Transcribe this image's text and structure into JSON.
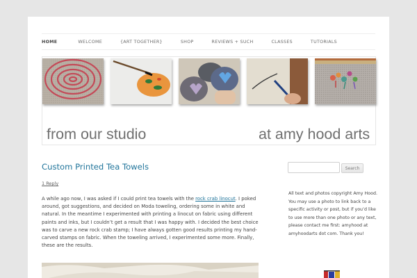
{
  "nav": {
    "items": [
      {
        "label": "HOME",
        "active": true
      },
      {
        "label": "WELCOME"
      },
      {
        "label": "{ART TOGETHER}"
      },
      {
        "label": "SHOP"
      },
      {
        "label": "REVIEWS + SUCH"
      },
      {
        "label": "CLASSES"
      },
      {
        "label": "TUTORIALS"
      }
    ]
  },
  "banner": {
    "caption_left": "from our studio",
    "caption_right": "at amy hood arts",
    "images": [
      "spiral-embroidery",
      "painting-fish-stone",
      "painted-heart-stones",
      "child-drawing",
      "stitched-letters"
    ]
  },
  "post": {
    "title": "Custom Printed Tea Towels",
    "reply": "1 Reply",
    "body_before_link": "A while ago now, I was asked if I could print tea towels with the ",
    "link_text": "rock crab linocut",
    "body_after_link": ". I poked around, got suggestions, and decided on Moda toweling, ordering some in white and natural. In the meantime I experimented with printing a linocut on fabric using different paints and inks, but I couldn’t get a result that I was happy with. I decided the best choice was to carve a new rock crab stamp; I have always gotten good results printing my hand-carved stamps on fabric. When the toweling arrived, I experimented some more. Finally, these are the results."
  },
  "sidebar": {
    "search_placeholder": "",
    "search_button": "Search",
    "copyright_text": "All text and photos copyright Amy Hood. You may use a photo to link back to a specific activity or post, but if you’d like to use more than one photo or any text, please contact me first: amyhood at amyhoodarts dot com. Thank you!"
  },
  "colors": {
    "link": "#21759b",
    "background": "#e6e6e6",
    "page": "#ffffff"
  }
}
